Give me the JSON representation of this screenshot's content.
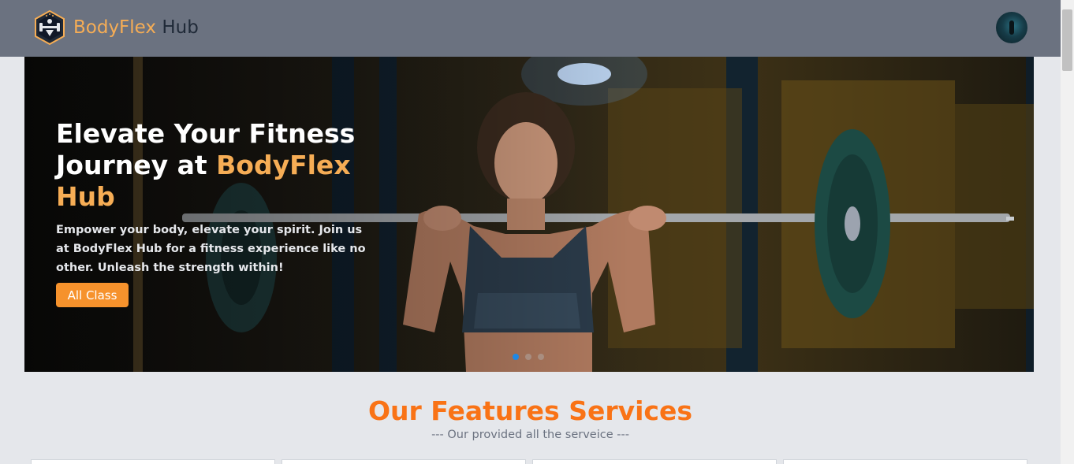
{
  "navbar": {
    "brand_primary": "BodyFlex",
    "brand_secondary": "Hub",
    "logo_icon": "dumbbell-shield-icon",
    "avatar_icon": "user-avatar"
  },
  "hero": {
    "title_part1": "Elevate Your Fitness Journey at ",
    "title_highlight": "BodyFlex Hub",
    "description": "Empower your body, elevate your spirit. Join us at BodyFlex Hub for a fitness experience like no other. Unleash the strength within!",
    "button_label": "All Class",
    "slides_count": 3,
    "active_slide": 1
  },
  "features": {
    "title": "Our Features Services",
    "subtitle": "--- Our provided all the serveice ---",
    "cards_visible": 4
  },
  "colors": {
    "navbar_bg": "#6b7280",
    "accent_orange": "#f6ad55",
    "features_title": "#f97316",
    "button_bg": "#f6922c",
    "page_bg": "#e5e7eb"
  }
}
